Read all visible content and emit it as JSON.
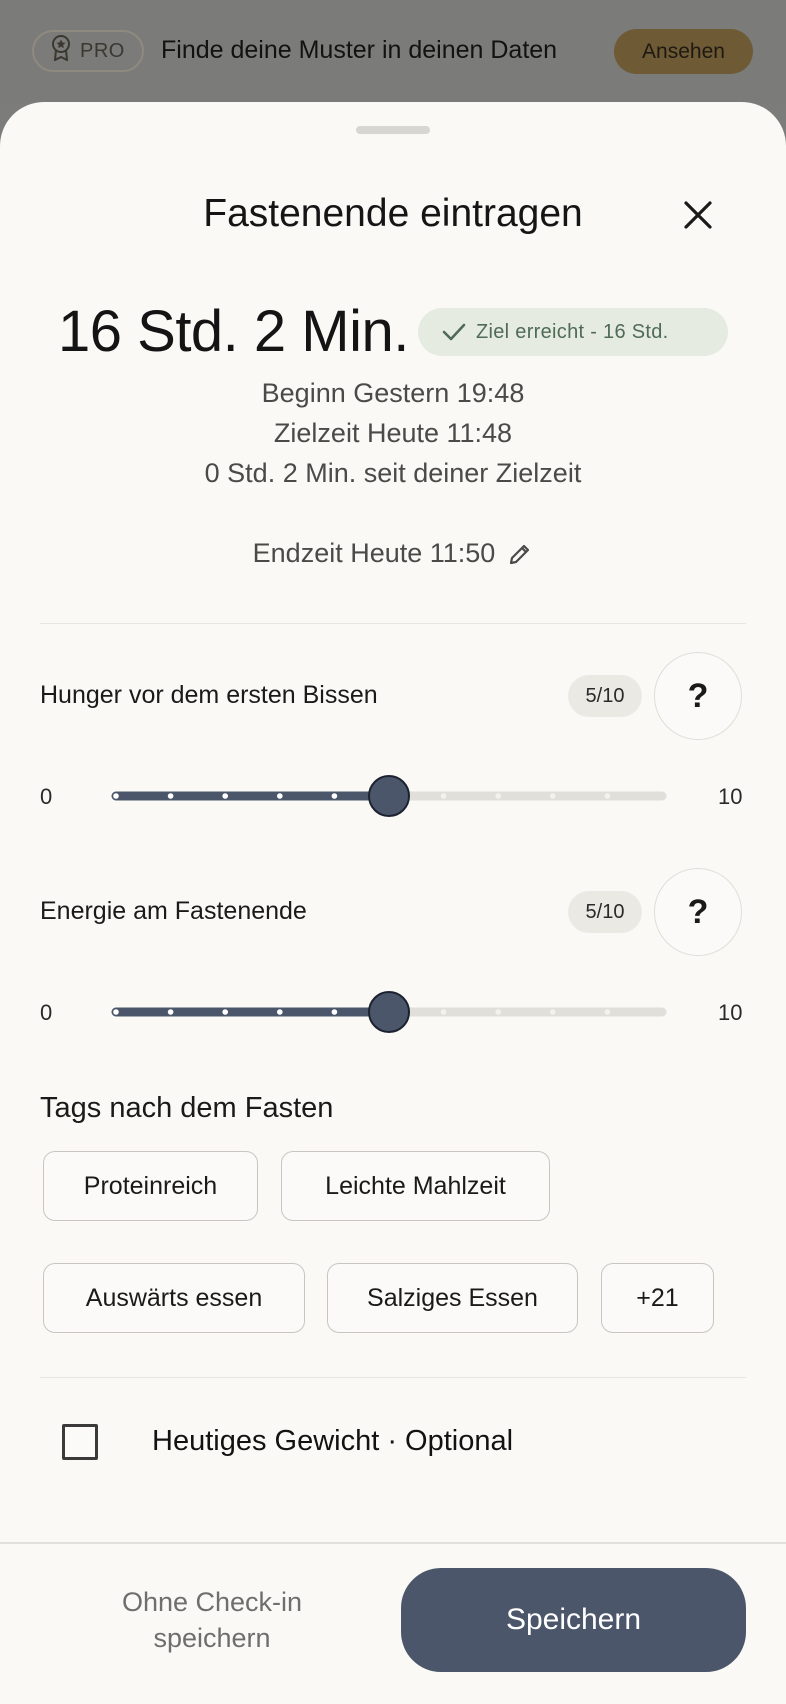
{
  "promo": {
    "pro_label": "PRO",
    "message": "Finde deine Muster in deinen Daten",
    "cta": "Ansehen",
    "icon": "award-icon"
  },
  "sheet": {
    "title": "Fastenende eintragen",
    "close_icon": "close-icon",
    "duration": "16 Std. 2 Min.",
    "goal_badge": "Ziel erreicht - 16 Std.",
    "start": "Beginn Gestern 19:48",
    "target": "Zielzeit Heute 11:48",
    "since_target": "0 Std. 2 Min. seit deiner Zielzeit",
    "end_time": "Endzeit Heute 11:50"
  },
  "questions": [
    {
      "label": "Hunger vor dem ersten Bissen",
      "badge": "5/10",
      "help": "?",
      "min": "0",
      "max": "10",
      "value": 5,
      "scale_max": 10
    },
    {
      "label": "Energie am Fastenende",
      "badge": "5/10",
      "help": "?",
      "min": "0",
      "max": "10",
      "value": 5,
      "scale_max": 10
    }
  ],
  "tags": {
    "title": "Tags nach dem Fasten",
    "items": [
      "Proteinreich",
      "Leichte Mahlzeit",
      "Auswärts essen",
      "Salziges Essen",
      "+21"
    ]
  },
  "weight": {
    "label": "Heutiges Gewicht · Optional",
    "checked": false
  },
  "footer": {
    "skip": "Ohne Check-in speichern",
    "save": "Speichern"
  },
  "colors": {
    "accent": "#4b566b",
    "sheet_bg": "#faf9f6",
    "badge_green_bg": "#e6ebe1",
    "badge_green_text": "#4f6b55",
    "track_inactive": "#e1dfda"
  }
}
